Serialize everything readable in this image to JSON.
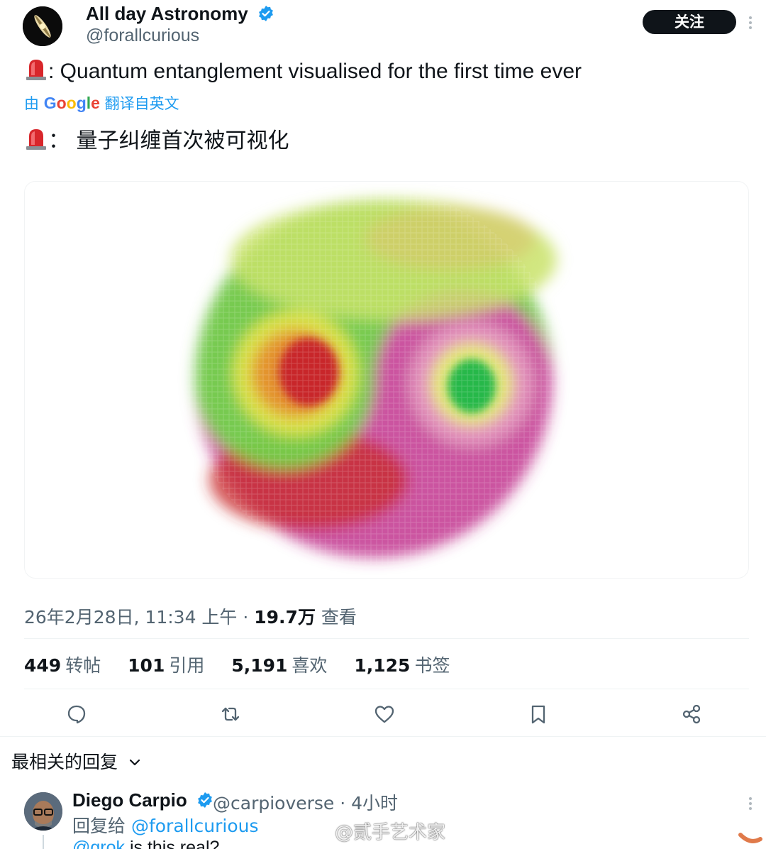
{
  "author": {
    "display_name": "All day Astronomy",
    "handle": "@forallcurious",
    "follow_label": "关注"
  },
  "tweet": {
    "text": ": Quantum entanglement visualised for the first time ever",
    "translate_prefix": "由",
    "translate_brand": "Google",
    "translate_suffix": "翻译自英文",
    "translated_text": "：  量子纠缠首次被可视化",
    "image_alt": "yin-yang quantum entanglement image"
  },
  "meta": {
    "timestamp": "26年2月28日, 11:34 上午 · ",
    "views_count": "19.7万",
    "views_label": " 查看"
  },
  "stats": [
    {
      "num": "449",
      "label": "转帖"
    },
    {
      "num": "101",
      "label": "引用"
    },
    {
      "num": "5,191",
      "label": "喜欢"
    },
    {
      "num": "1,125",
      "label": "书签"
    }
  ],
  "replies": {
    "header": "最相关的回复",
    "items": [
      {
        "name": "Diego Carpio",
        "meta": "@carpioverse · 4小时",
        "reply_prefix": "回复给 ",
        "reply_mention": "@forallcurious",
        "text_mention": "@grok",
        "text": " is this real?"
      }
    ]
  },
  "watermark": "@贰手艺术家",
  "colors": {
    "accent": "#1d9bf0",
    "text": "#0f1419",
    "muted": "#536471",
    "green": "#5fd34a",
    "magenta": "#c2378f",
    "red": "#c8282a"
  },
  "icons": [
    "verified-icon",
    "siren-icon",
    "reply-icon",
    "repost-icon",
    "like-icon",
    "bookmark-icon",
    "share-icon",
    "more-icon",
    "chevron-down-icon"
  ]
}
